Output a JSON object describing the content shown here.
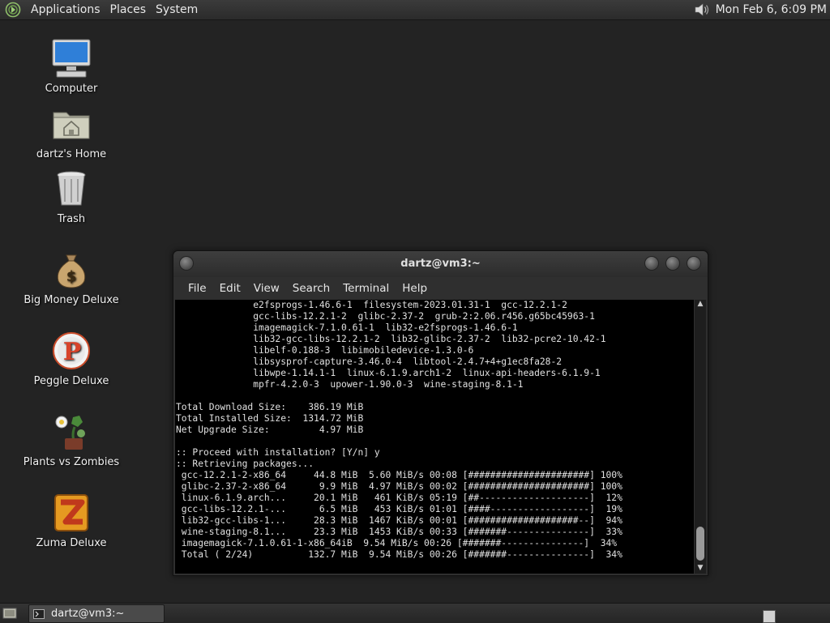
{
  "top_panel": {
    "menus": [
      "Applications",
      "Places",
      "System"
    ],
    "clock": "Mon Feb  6,  6:09 PM"
  },
  "desktop_icons": [
    {
      "label": "Computer",
      "icon": "computer-icon"
    },
    {
      "label": "dartz's Home",
      "icon": "home-folder-icon"
    },
    {
      "label": "Trash",
      "icon": "trash-icon"
    },
    {
      "label": "Big Money Deluxe",
      "icon": "money-bag-icon"
    },
    {
      "label": "Peggle Deluxe",
      "icon": "peggle-icon"
    },
    {
      "label": "Plants vs Zombies",
      "icon": "plants-vs-zombies-icon"
    },
    {
      "label": "Zuma Deluxe",
      "icon": "zuma-icon"
    }
  ],
  "terminal": {
    "title": "dartz@vm3:~",
    "menu": [
      "File",
      "Edit",
      "View",
      "Search",
      "Terminal",
      "Help"
    ],
    "output": "              e2fsprogs-1.46.6-1  filesystem-2023.01.31-1  gcc-12.2.1-2\n              gcc-libs-12.2.1-2  glibc-2.37-2  grub-2:2.06.r456.g65bc45963-1\n              imagemagick-7.1.0.61-1  lib32-e2fsprogs-1.46.6-1\n              lib32-gcc-libs-12.2.1-2  lib32-glibc-2.37-2  lib32-pcre2-10.42-1\n              libelf-0.188-3  libimobiledevice-1.3.0-6\n              libsysprof-capture-3.46.0-4  libtool-2.4.7+4+g1ec8fa28-2\n              libwpe-1.14.1-1  linux-6.1.9.arch1-2  linux-api-headers-6.1.9-1\n              mpfr-4.2.0-3  upower-1.90.0-3  wine-staging-8.1-1\n\nTotal Download Size:    386.19 MiB\nTotal Installed Size:  1314.72 MiB\nNet Upgrade Size:         4.97 MiB\n\n:: Proceed with installation? [Y/n] y\n:: Retrieving packages...\n gcc-12.2.1-2-x86_64     44.8 MiB  5.60 MiB/s 00:08 [######################] 100%\n glibc-2.37-2-x86_64      9.9 MiB  4.97 MiB/s 00:02 [######################] 100%\n linux-6.1.9.arch...     20.1 MiB   461 KiB/s 05:19 [##--------------------]  12%\n gcc-libs-12.2.1-...      6.5 MiB   453 KiB/s 01:01 [####------------------]  19%\n lib32-gcc-libs-1...     28.3 MiB  1467 KiB/s 00:01 [####################--]  94%\n wine-staging-8.1...     23.3 MiB  1453 KiB/s 00:33 [#######---------------]  33%\n imagemagick-7.1.0.61-1-x86_64iB  9.54 MiB/s 00:26 [#######---------------]  34%\n Total ( 2/24)          132.7 MiB  9.54 MiB/s 00:26 [#######---------------]  34%"
  },
  "taskbar": {
    "window_button": "dartz@vm3:~"
  }
}
